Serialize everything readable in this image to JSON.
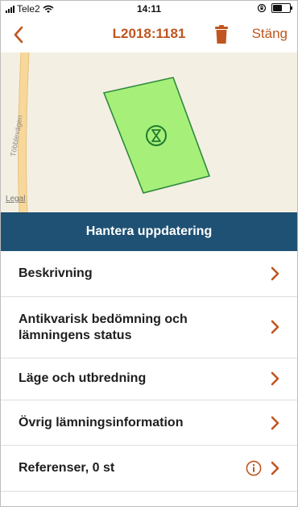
{
  "status_bar": {
    "carrier": "Tele2",
    "time": "14:11",
    "battery_level": 0.6,
    "icons": [
      "signal-bars-icon",
      "wifi-icon",
      "rotation-lock-icon",
      "battery-icon"
    ]
  },
  "nav": {
    "title": "L2018:1181",
    "close_label": "Stäng",
    "icons": [
      "chevron-left-icon",
      "trash-icon"
    ],
    "accent_color": "#c0551f"
  },
  "map": {
    "road_name": "Többlevägen",
    "legal_label": "Legal",
    "polygon_color": "#a6f07a",
    "marker_icon": "hourglass-icon"
  },
  "action": {
    "label": "Hantera uppdatering",
    "color": "#1f5174"
  },
  "menu": {
    "items": [
      {
        "label": "Beskrivning"
      },
      {
        "label": "Antikvarisk bedömning och",
        "label2": "lämningens status"
      },
      {
        "label": "Läge och utbredning"
      },
      {
        "label": "Övrig lämningsinformation"
      },
      {
        "label": "Referenser, 0 st"
      }
    ],
    "icons": [
      "chevron-right-icon",
      "info-icon"
    ]
  }
}
